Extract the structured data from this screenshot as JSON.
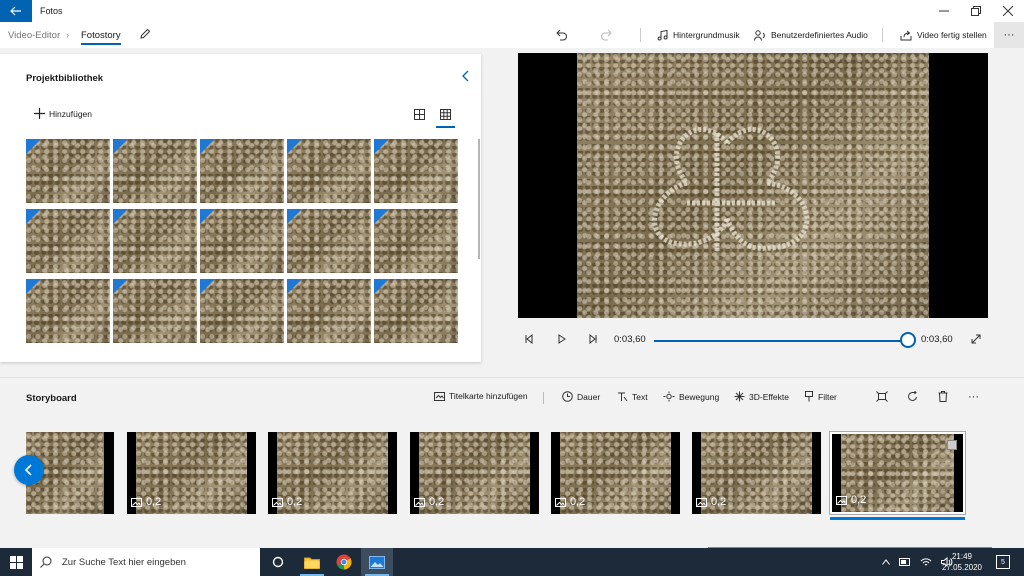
{
  "titlebar": {
    "app_title": "Fotos"
  },
  "breadcrumb": {
    "editor": "Video-Editor",
    "separator": "›",
    "current": "Fotostory"
  },
  "commands": {
    "background_music": "Hintergrundmusik",
    "custom_audio": "Benutzerdefiniertes Audio",
    "finish_video": "Video fertig stellen",
    "more": "···"
  },
  "library": {
    "title": "Projektbibliothek",
    "add_label": "Hinzufügen",
    "thumbnail_count": 15
  },
  "player": {
    "current_time": "0:03,60",
    "total_time": "0:03,60",
    "progress": 1.0
  },
  "storyboard": {
    "title": "Storyboard",
    "tools": {
      "add_title_card": "Titelkarte hinzufügen",
      "duration": "Dauer",
      "text": "Text",
      "motion": "Bewegung",
      "effects_3d": "3D-Effekte",
      "filter": "Filter",
      "more": "···"
    },
    "clips": [
      {
        "duration": ""
      },
      {
        "duration": "0,2"
      },
      {
        "duration": "0,2"
      },
      {
        "duration": "0,2"
      },
      {
        "duration": "0,2"
      },
      {
        "duration": "0,2"
      },
      {
        "duration": "0,2"
      }
    ]
  },
  "taskbar": {
    "search_placeholder": "Zur Suche Text hier eingeben",
    "time": "21:49",
    "date": "27.05.2020",
    "notification_count": "5"
  },
  "colors": {
    "accent": "#0063b1",
    "taskbar": "#1c2a3a"
  }
}
